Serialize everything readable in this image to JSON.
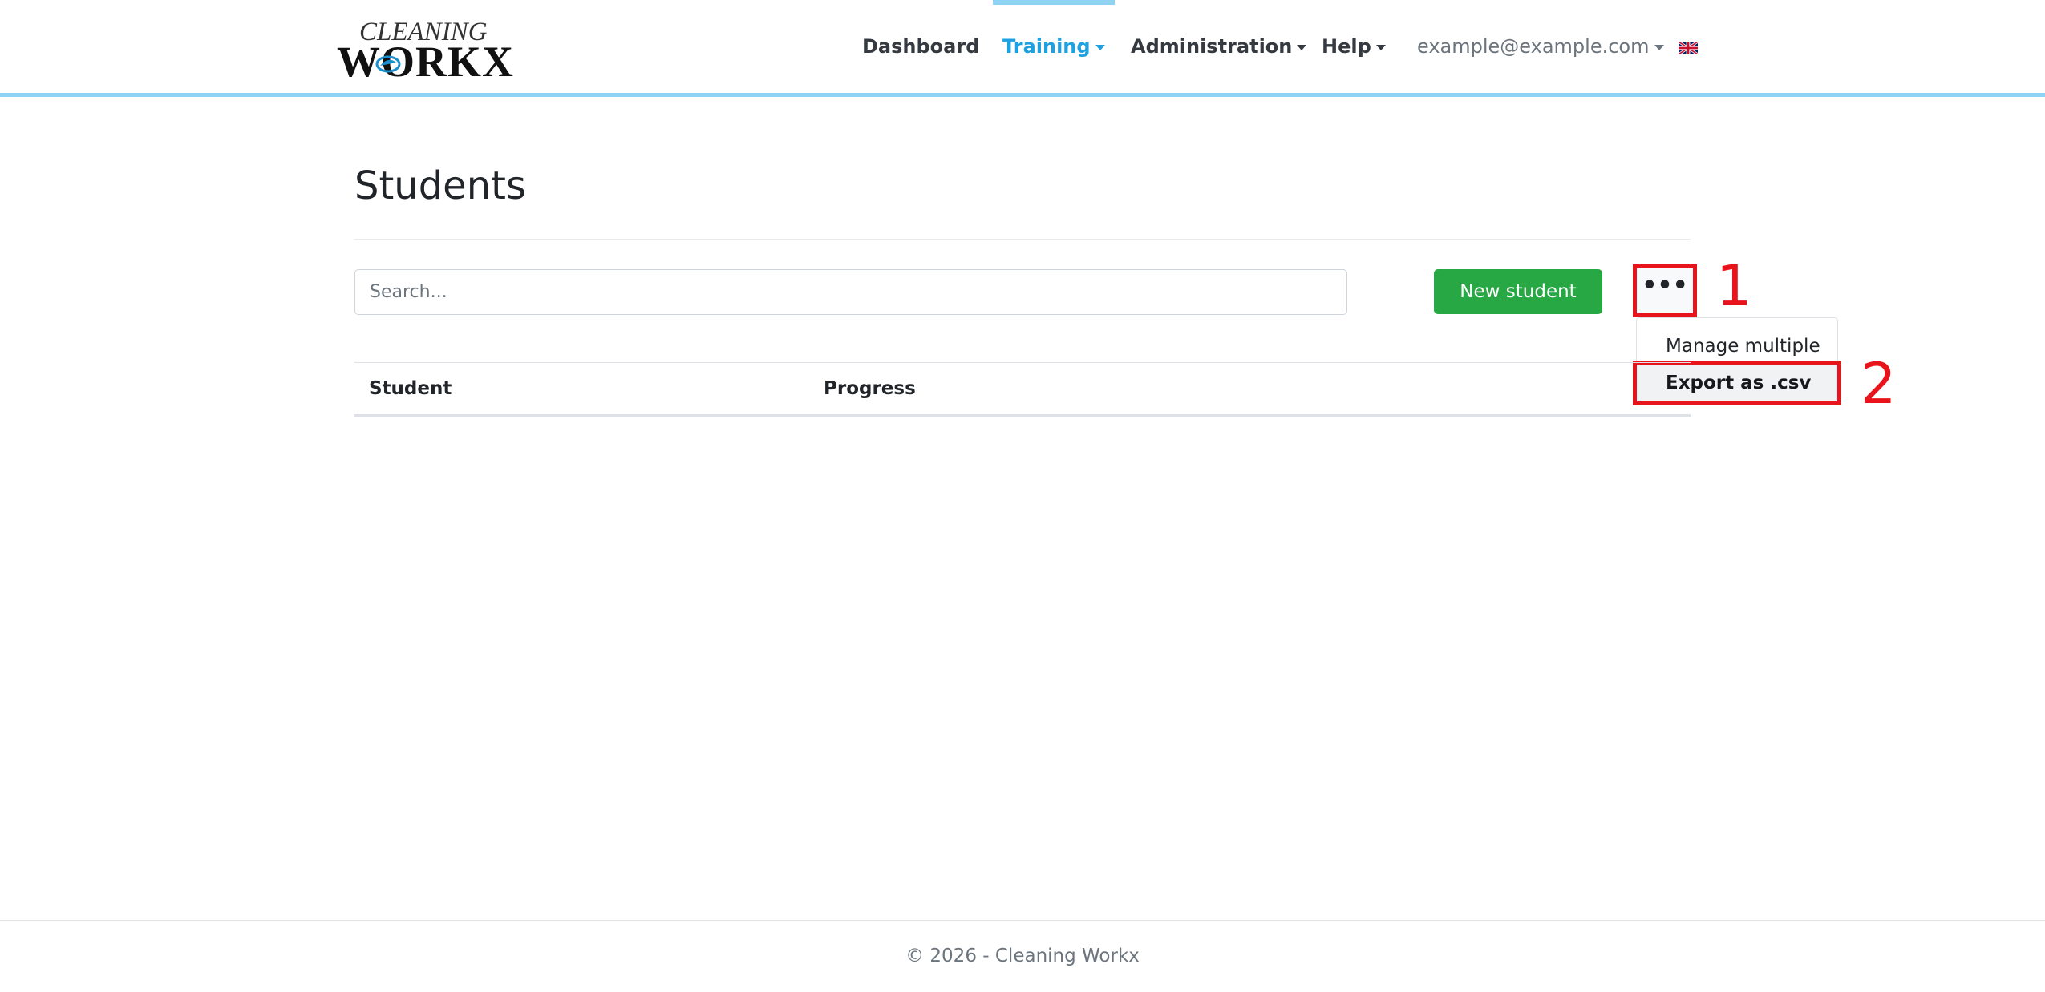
{
  "brand": {
    "logo_top": "CLEANING",
    "logo_bottom": "WORKX"
  },
  "nav": {
    "dashboard": "Dashboard",
    "training": "Training",
    "administration": "Administration",
    "help": "Help",
    "user": "example@example.com",
    "language_icon": "uk-flag-icon"
  },
  "colors": {
    "accent": "#8ed3f3",
    "active_link": "#1ea1e0",
    "new_button": "#28a745",
    "annotation": "#e8141c"
  },
  "page": {
    "title": "Students",
    "search_placeholder": "Search...",
    "new_button": "New student",
    "more_button": "•••"
  },
  "dropdown": {
    "items": [
      "Manage multiple",
      "Export as .csv"
    ]
  },
  "annotations": [
    "1",
    "2"
  ],
  "table": {
    "columns": [
      "Student",
      "Progress"
    ],
    "rows": []
  },
  "footer": {
    "text": "© 2026 - Cleaning Workx"
  }
}
